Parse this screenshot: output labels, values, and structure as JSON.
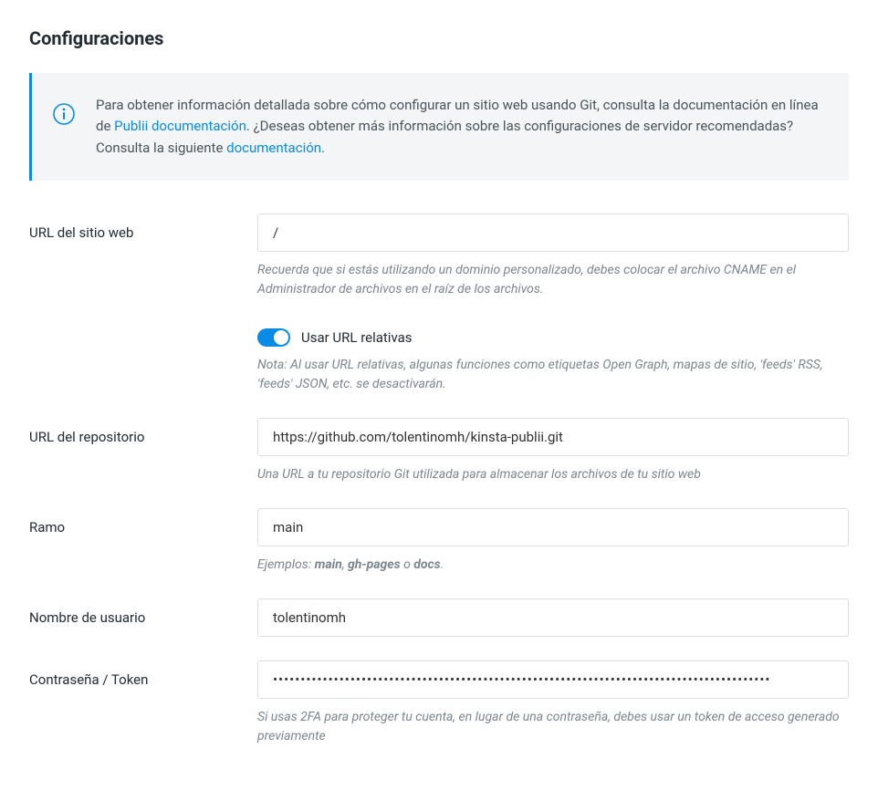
{
  "page": {
    "title": "Configuraciones"
  },
  "info": {
    "icon": "info-icon",
    "pre": "Para obtener información detallada sobre cómo configurar un sitio web usando Git, consulta la documentación en línea de ",
    "link1": "Publii documentación",
    "mid": ". ¿Deseas obtener más información sobre las configuraciones de servidor recomendadas? Consulta la siguiente ",
    "link2": "documentación",
    "post": "."
  },
  "fields": {
    "website_url": {
      "label": "URL del sitio web",
      "value": "/",
      "help": "Recuerda que si estás utilizando un dominio personalizado, debes colocar el archivo CNAME en el Administrador de archivos en el raíz de los archivos."
    },
    "relative_urls": {
      "label": "Usar URL relativas",
      "help": "Nota: Al usar URL relativas, algunas funciones como etiquetas Open Graph, mapas de sitio, 'feeds' RSS, 'feeds' JSON, etc. se desactivarán.",
      "on": true
    },
    "repo_url": {
      "label": "URL del repositorio",
      "value": "https://github.com/tolentinomh/kinsta-publii.git",
      "help": "Una URL a tu repositorio Git utilizada para almacenar los archivos de tu sitio web"
    },
    "branch": {
      "label": "Ramo",
      "value": "main",
      "help_pre": "Ejemplos: ",
      "ex1": "main",
      "sep1": ", ",
      "ex2": "gh-pages",
      "sep2": " o ",
      "ex3": "docs",
      "post": "."
    },
    "username": {
      "label": "Nombre de usuario",
      "value": "tolentinomh"
    },
    "password": {
      "label": "Contraseña / Token",
      "value": "••••••••••••••••••••••••••••••••••••••••••••••••••••••••••••••••••••••••••••••••••••••••••",
      "help": "Si usas 2FA para proteger tu cuenta, en lugar de una contraseña, debes usar un token de acceso generado previamente"
    }
  }
}
